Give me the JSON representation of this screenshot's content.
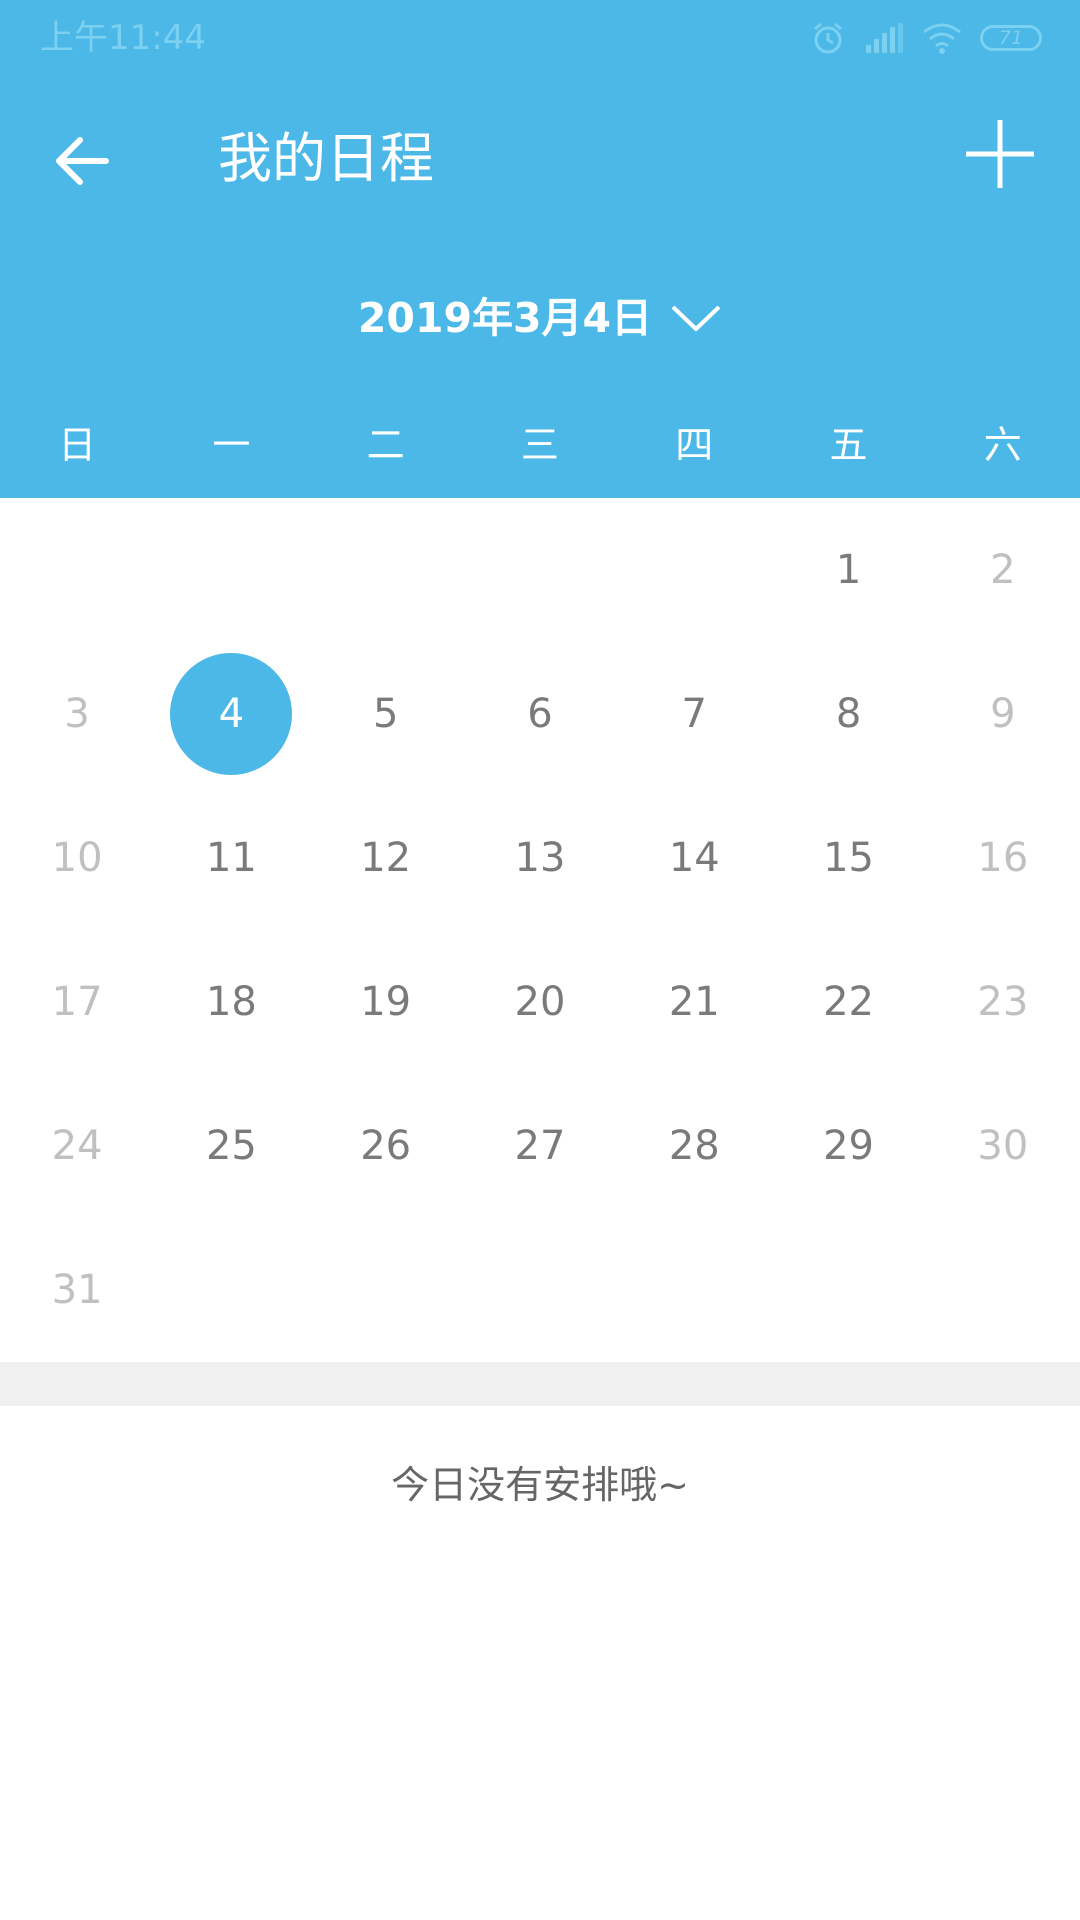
{
  "status_bar": {
    "time": "上午11:44",
    "battery": "71",
    "icons": [
      "alarm-icon",
      "signal-icon",
      "wifi-icon",
      "battery-icon"
    ]
  },
  "toolbar": {
    "title": "我的日程",
    "back_icon": "arrow-left-icon",
    "add_icon": "plus-icon"
  },
  "date_selector": {
    "label": "2019年3月4日",
    "icon": "chevron-down-icon"
  },
  "weekdays": [
    "日",
    "一",
    "二",
    "三",
    "四",
    "五",
    "六"
  ],
  "calendar": {
    "first_weekday_index": 5,
    "days_in_month": 31,
    "selected_day": 4
  },
  "schedule": {
    "empty_message": "今日没有安排哦~"
  },
  "colors": {
    "primary": "#4bb8e7",
    "weekday_text": "#7a7a7a",
    "weekend_text": "#c0c0c0",
    "divider": "#f0f0f0"
  }
}
